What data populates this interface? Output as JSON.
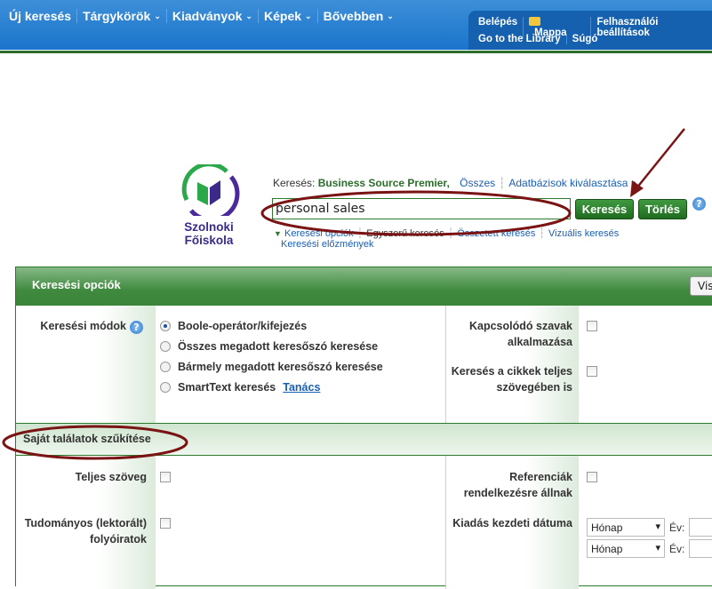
{
  "nav": {
    "items": [
      {
        "label": "Új keresés",
        "dropdown": false
      },
      {
        "label": "Tárgykörök",
        "dropdown": true
      },
      {
        "label": "Kiadványok",
        "dropdown": true
      },
      {
        "label": "Képek",
        "dropdown": true
      },
      {
        "label": "Bővebben",
        "dropdown": true
      }
    ]
  },
  "account": {
    "login": "Belépés",
    "folder": "Mappa",
    "prefs": "Felhasználói beállítások",
    "library": "Go to the Library",
    "help": "Súgó"
  },
  "logo": {
    "name": "Szolnoki Főiskola"
  },
  "search": {
    "label": "Keresés:",
    "database": "Business Source Premier,",
    "all": "Összes",
    "choose_db": "Adatbázisok kiválasztása »",
    "query": "personal sales",
    "search_btn": "Keresés",
    "clear_btn": "Törlés",
    "help": "?"
  },
  "links": {
    "options": "Keresési opciók",
    "basic": "Egyszerű keresés",
    "advanced": "Összetett keresés",
    "visual": "Vizuális keresés",
    "history": "Keresési előzmények"
  },
  "options": {
    "title": "Keresési opciók",
    "reset_btn": "Vis",
    "modes_label": "Keresési módok",
    "modes": [
      {
        "label": "Boole-operátor/kifejezés",
        "selected": true
      },
      {
        "label": "Összes megadott keresőszó keresése",
        "selected": false
      },
      {
        "label": "Bármely megadott keresőszó keresése",
        "selected": false
      },
      {
        "label": "SmartText keresés",
        "selected": false
      }
    ],
    "tip": "Tanács",
    "related": "Kapcsolódó szavak alkalmazása",
    "fulltext_search": "Keresés a cikkek teljes szövegében is"
  },
  "limit": {
    "title": "Saját találatok szűkítése",
    "fulltext": "Teljes szöveg",
    "peer": "Tudományos (lektorált) folyóiratok",
    "refs": "Referenciák rendelkezésre állnak",
    "pubdate": "Kiadás kezdeti dátuma",
    "month": "Hónap",
    "year": "Év:"
  },
  "colors": {
    "nav_blue": "#1a74cb",
    "green": "#2b7a2b",
    "annotation": "#7a1414"
  }
}
